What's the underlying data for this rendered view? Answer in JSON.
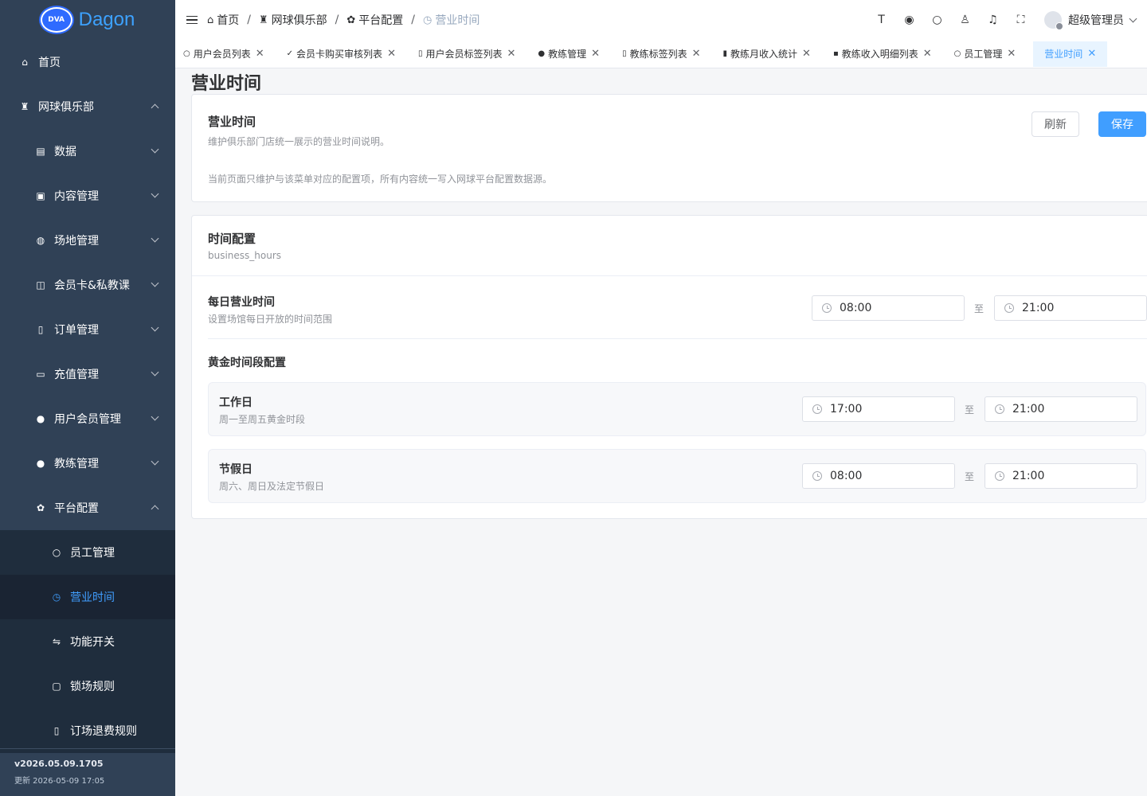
{
  "app": {
    "logo_text": "Dagon",
    "logo_mark": "DVA"
  },
  "sidebar": {
    "items": [
      {
        "label": "首页",
        "icon": "home-icon"
      },
      {
        "label": "网球俱乐部",
        "icon": "trophy-icon"
      },
      {
        "label": "数据",
        "icon": "chart-icon"
      },
      {
        "label": "内容管理",
        "icon": "image-icon"
      },
      {
        "label": "场地管理",
        "icon": "ball-icon"
      },
      {
        "label": "会员卡&私教课",
        "icon": "book-icon"
      },
      {
        "label": "订单管理",
        "icon": "document-icon"
      },
      {
        "label": "充值管理",
        "icon": "folder-icon"
      },
      {
        "label": "用户会员管理",
        "icon": "user-icon"
      },
      {
        "label": "教练管理",
        "icon": "user-icon"
      },
      {
        "label": "平台配置",
        "icon": "gear-icon"
      },
      {
        "label": "员工管理",
        "icon": "user-outline-icon"
      },
      {
        "label": "营业时间",
        "icon": "clock-icon"
      },
      {
        "label": "功能开关",
        "icon": "switch-icon"
      },
      {
        "label": "锁场规则",
        "icon": "lock-icon"
      },
      {
        "label": "订场退费规则",
        "icon": "document-icon"
      }
    ],
    "version": "v2026.05.09.1705",
    "updated": "更新 2026-05-09 17:05"
  },
  "header": {
    "breadcrumb": [
      "首页",
      "网球俱乐部",
      "平台配置",
      "营业时间"
    ],
    "user_name": "超级管理员"
  },
  "tags": [
    {
      "label": "用户会员列表"
    },
    {
      "label": "会员卡购买审核列表"
    },
    {
      "label": "用户会员标签列表"
    },
    {
      "label": "教练管理"
    },
    {
      "label": "教练标签列表"
    },
    {
      "label": "教练月收入统计"
    },
    {
      "label": "教练收入明细列表"
    },
    {
      "label": "员工管理"
    },
    {
      "label": "营业时间"
    }
  ],
  "page": {
    "title": "营业时间",
    "intro": {
      "title": "营业时间",
      "subtitle": "维护俱乐部门店统一展示的营业时间说明。",
      "note": "当前页面只维护与该菜单对应的配置项，所有内容统一写入网球平台配置数据源。",
      "refresh_label": "刷新",
      "save_label": "保存"
    },
    "config": {
      "title": "时间配置",
      "key": "business_hours",
      "daily": {
        "label": "每日营业时间",
        "desc": "设置场馆每日开放的时间范围",
        "start": "08:00",
        "end": "21:00"
      },
      "golden_title": "黄金时间段配置",
      "workday": {
        "label": "工作日",
        "desc": "周一至周五黄金时段",
        "start": "17:00",
        "end": "21:00"
      },
      "holiday": {
        "label": "节假日",
        "desc": "周六、周日及法定节假日",
        "start": "08:00",
        "end": "21:00"
      },
      "range_sep": "至"
    }
  }
}
